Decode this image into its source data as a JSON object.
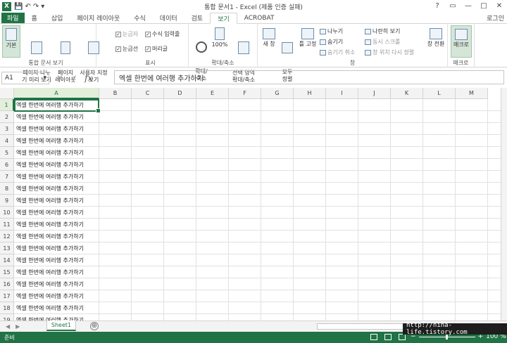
{
  "window": {
    "title": "통합 문서1 - Excel (제품 인증 실패)",
    "app_icon": "X",
    "controls": [
      "?",
      "▭",
      "—",
      "□",
      "✕"
    ]
  },
  "qat": {
    "save": "💾",
    "undo": "↶",
    "redo": "↷",
    "custom": "▾"
  },
  "tabs": [
    "파일",
    "홈",
    "삽입",
    "페이지 레이아웃",
    "수식",
    "데이터",
    "검토",
    "보기",
    "ACROBAT"
  ],
  "active_tab": "보기",
  "account": "로그인",
  "ribbon": {
    "workbook_views": {
      "label": "통합 문서 보기",
      "buttons": [
        "기본",
        "페이지 나누\n기 미리 보기",
        "페이지\n레이아웃",
        "사용자 지정\n보기"
      ]
    },
    "show": {
      "label": "표시",
      "checks": [
        {
          "label": "눈금자",
          "checked": true,
          "enabled": false
        },
        {
          "label": "수식 입력줄",
          "checked": true,
          "enabled": true
        },
        {
          "label": "눈금선",
          "checked": true,
          "enabled": true
        },
        {
          "label": "머리글",
          "checked": true,
          "enabled": true
        }
      ]
    },
    "zoom": {
      "label": "확대/축소",
      "buttons": [
        "확대/\n축소",
        "100%",
        "선택 영역\n확대/축소"
      ]
    },
    "window": {
      "label": "창",
      "buttons": [
        "새 창",
        "모두\n정렬",
        "틀 고정"
      ],
      "small": [
        {
          "label": "나누기",
          "enabled": true
        },
        {
          "label": "숨기기",
          "enabled": true
        },
        {
          "label": "숨기기 취소",
          "enabled": false
        },
        {
          "label": "나란히 보기",
          "enabled": true
        },
        {
          "label": "동시 스크롤",
          "enabled": false
        },
        {
          "label": "창 위치 다시 정렬",
          "enabled": false
        }
      ],
      "switch": "창 전환"
    },
    "macros": {
      "label": "매크로",
      "button": "매크로"
    }
  },
  "formula_bar": {
    "name_box": "A1",
    "cancel": "✕",
    "enter": "✓",
    "fx": "fx",
    "content": "엑셀 한번에 여러행 추가하기"
  },
  "columns": [
    "A",
    "B",
    "C",
    "D",
    "E",
    "F",
    "G",
    "H",
    "I",
    "J",
    "K",
    "L",
    "M"
  ],
  "rows": [
    "1",
    "2",
    "3",
    "4",
    "5",
    "6",
    "7",
    "8",
    "9",
    "10",
    "11",
    "12",
    "13",
    "14",
    "15",
    "16",
    "17",
    "18",
    "19"
  ],
  "cells": {
    "A": [
      "엑셀 한번에 여러행 추가하기",
      "엑셀 한번에 여러행 추가하기",
      "엑셀 한번에 여러행 추가하기",
      "엑셀 한번에 여러행 추가하기",
      "엑셀 한번에 여러행 추가하기",
      "엑셀 한번에 여러행 추가하기",
      "엑셀 한번에 여러행 추가하기",
      "엑셀 한번에 여러행 추가하기",
      "엑셀 한번에 여러행 추가하기",
      "엑셀 한번에 여러행 추가하기",
      "엑셀 한번에 여러행 추가하기",
      "엑셀 한번에 여러행 추가하기",
      "엑셀 한번에 여러행 추가하기",
      "엑셀 한번에 여러행 추가하기",
      "엑셀 한번에 여러행 추가하기",
      "엑셀 한번에 여러행 추가하기",
      "엑셀 한번에 여러행 추가하기",
      "엑셀 한번에 여러행 추가하기",
      "엑셀 한번에 여러행 추가하기"
    ]
  },
  "sheet_tabs": [
    "Sheet1"
  ],
  "add_sheet": "⊕",
  "status": {
    "text": "준비",
    "zoom": "100 %",
    "zoom_minus": "−",
    "zoom_plus": "+"
  },
  "watermark": "http://nina-life.tistory.com",
  "colors": {
    "accent": "#217346",
    "header_bg": "#f3f3f3",
    "selected_header": "#e2efda"
  }
}
